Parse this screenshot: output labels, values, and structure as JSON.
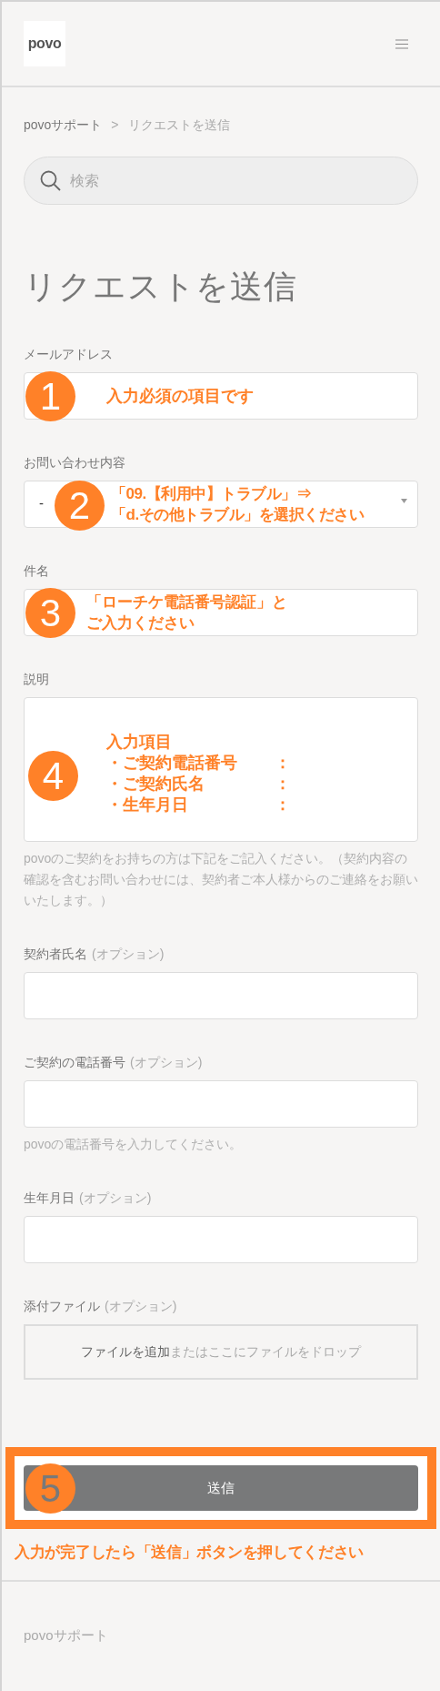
{
  "header": {
    "logo": "povo"
  },
  "breadcrumb": {
    "items": [
      {
        "label": "povoサポート"
      },
      {
        "label": "リクエストを送信"
      }
    ],
    "separator": ">"
  },
  "search": {
    "placeholder": "検索"
  },
  "title": "リクエストを送信",
  "fields": [
    {
      "kind": "text",
      "label": "メールアドレス",
      "annotation": {
        "number": "1",
        "lines": [
          "入力必須の項目です"
        ]
      }
    },
    {
      "kind": "select",
      "label": "お問い合わせ内容",
      "value": "-",
      "annotation": {
        "number": "2",
        "lines": [
          "「09.【利用中】トラブル」⇒",
          "「d.その他トラブル」を選択ください"
        ]
      }
    },
    {
      "kind": "text",
      "label": "件名",
      "annotation": {
        "number": "3",
        "lines": [
          "「ローチケ電話番号認証」と",
          "ご入力ください"
        ]
      }
    },
    {
      "kind": "textarea",
      "label": "説明",
      "annotation": {
        "number": "4",
        "heading": "入力項目",
        "items": [
          {
            "label": "・ご契約電話番号",
            "colon": "："
          },
          {
            "label": "・ご契約氏名",
            "colon": "："
          },
          {
            "label": "・生年月日",
            "colon": "："
          }
        ]
      },
      "help": "povoのご契約をお持ちの方は下記をご記入ください。（契約内容の確認を含むお問い合わせには、契約者ご本人様からのご連絡をお願いいたします。）"
    },
    {
      "kind": "text",
      "label": "契約者氏名",
      "optional": "(オプション)"
    },
    {
      "kind": "text",
      "label": "ご契約の電話番号",
      "optional": "(オプション)",
      "help": "povoの電話番号を入力してください。"
    },
    {
      "kind": "text",
      "label": "生年月日",
      "optional": "(オプション)"
    },
    {
      "kind": "file",
      "label": "添付ファイル",
      "optional": "(オプション)",
      "link": "ファイルを追加",
      "hint": "またはここにファイルをドロップ"
    }
  ],
  "submit": {
    "label": "送信",
    "annotation": {
      "number": "5",
      "caption": "入力が完了したら「送信」ボタンを押してください"
    }
  },
  "footer": {
    "text": "povoサポート"
  }
}
